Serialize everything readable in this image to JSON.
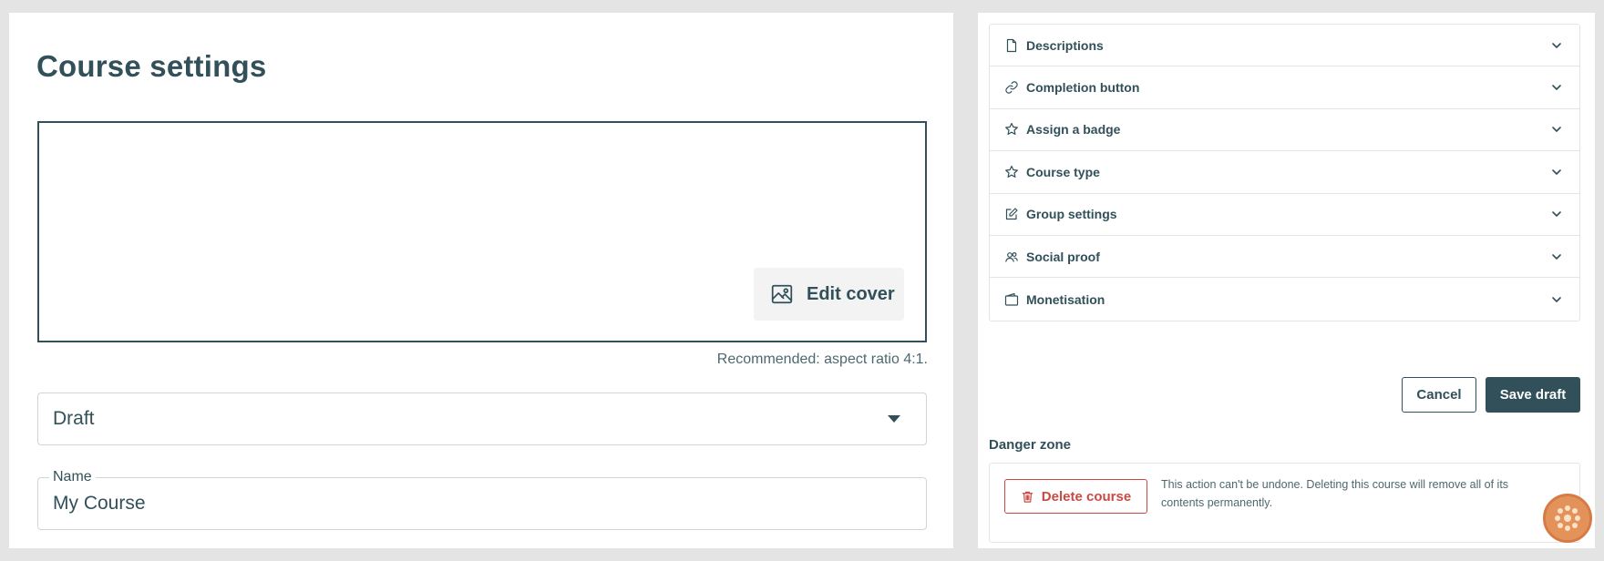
{
  "left": {
    "title": "Course settings",
    "edit_cover_label": "Edit cover",
    "cover_hint": "Recommended: aspect ratio 4:1.",
    "status": {
      "selected": "Draft"
    },
    "name_field": {
      "label": "Name",
      "value": "My Course"
    }
  },
  "right": {
    "accordion": [
      {
        "label": "Descriptions",
        "icon": "document-icon"
      },
      {
        "label": "Completion button",
        "icon": "link-icon"
      },
      {
        "label": "Assign a badge",
        "icon": "star-icon"
      },
      {
        "label": "Course type",
        "icon": "star-icon"
      },
      {
        "label": "Group settings",
        "icon": "edit-icon"
      },
      {
        "label": "Social proof",
        "icon": "users-icon"
      },
      {
        "label": "Monetisation",
        "icon": "wallet-icon"
      }
    ],
    "cancel_label": "Cancel",
    "save_label": "Save draft",
    "danger_zone": {
      "title": "Danger zone",
      "delete_label": "Delete course",
      "warning": "This action can't be undone. Deleting this course will remove all of its contents permanently."
    }
  },
  "colors": {
    "primary": "#31505a",
    "danger": "#c94a43",
    "border": "#e1e5e6",
    "background": "#e4e4e4",
    "avatar": "#e3935a"
  }
}
